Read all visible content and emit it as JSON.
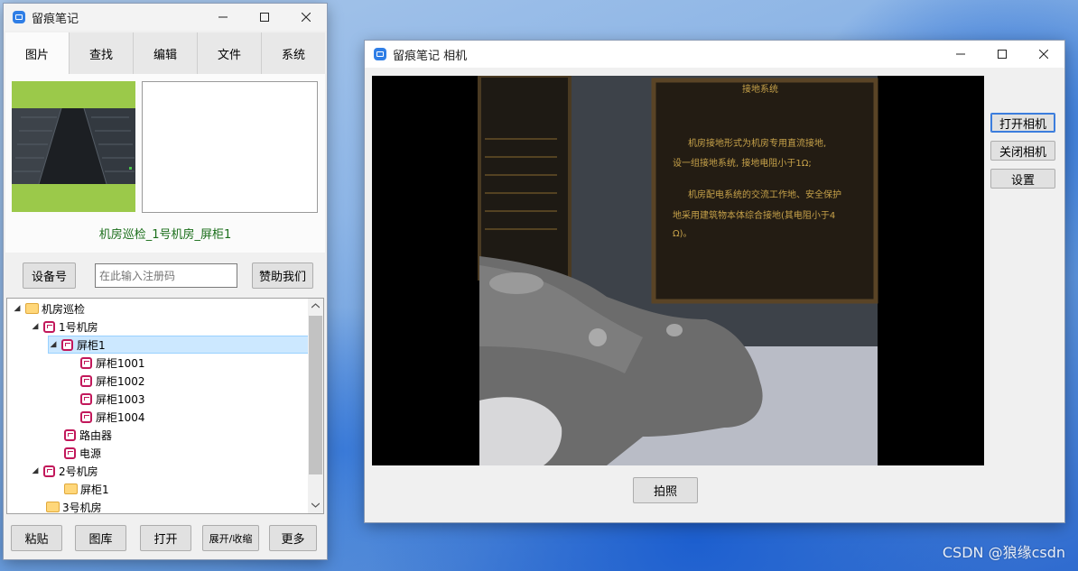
{
  "left_window": {
    "title": "留痕笔记",
    "tabs": [
      {
        "label": "图片",
        "active": true
      },
      {
        "label": "查找"
      },
      {
        "label": "编辑"
      },
      {
        "label": "文件"
      },
      {
        "label": "系统"
      }
    ],
    "image_caption": "机房巡检_1号机房_屏柜1",
    "device_button": "设备号",
    "register_placeholder": "在此输入注册码",
    "donate_button": "赞助我们",
    "tree": [
      {
        "label": "机房巡检",
        "icon": "folder-icon",
        "expanded": true
      },
      {
        "label": "1号机房",
        "icon": "note-icon",
        "expanded": true
      },
      {
        "label": "屏柜1",
        "icon": "note-icon",
        "expanded": true,
        "selected": true
      },
      {
        "label": "屏柜1001",
        "icon": "note-icon"
      },
      {
        "label": "屏柜1002",
        "icon": "note-icon"
      },
      {
        "label": "屏柜1003",
        "icon": "note-icon"
      },
      {
        "label": "屏柜1004",
        "icon": "note-icon"
      },
      {
        "label": "路由器",
        "icon": "note-icon"
      },
      {
        "label": "电源",
        "icon": "note-icon"
      },
      {
        "label": "2号机房",
        "icon": "note-icon",
        "expanded": true
      },
      {
        "label": "屏柜1",
        "icon": "folder-icon"
      },
      {
        "label": "3号机房",
        "icon": "folder-icon"
      }
    ],
    "bottom_buttons": [
      "粘贴",
      "图库",
      "打开",
      "展开/收缩",
      "更多"
    ]
  },
  "camera_window": {
    "title": "留痕笔记 相机",
    "open_camera": "打开相机",
    "close_camera": "关闭相机",
    "settings": "设置",
    "capture": "拍照",
    "preview_text": {
      "sign_title": "接地系统",
      "sign_line1": "机房接地形式为机房专用直流接地,",
      "sign_line2": "设一组接地系统, 接地电阻小于1Ω;",
      "sign_line3": "机房配电系统的交流工作地、安全保护",
      "sign_line4": "地采用建筑物本体综合接地(其电阻小于4",
      "sign_line5": "Ω)。"
    }
  },
  "watermark": "CSDN @狼缘csdn",
  "colors": {
    "accent": "#2f7ee6",
    "selection": "#cce8ff",
    "caption_green": "#1a6e1a"
  }
}
